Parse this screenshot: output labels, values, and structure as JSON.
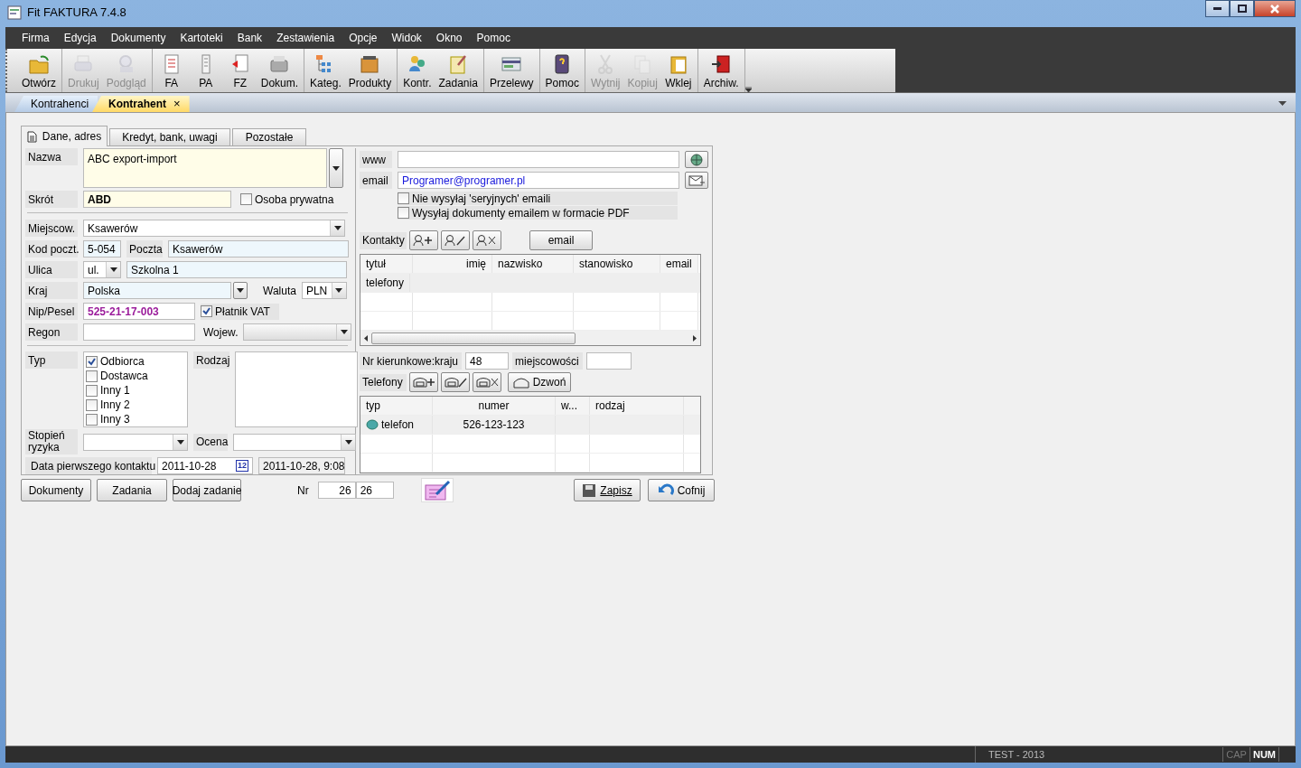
{
  "window": {
    "title": "Fit FAKTURA 7.4.8"
  },
  "menu": [
    "Firma",
    "Edycja",
    "Dokumenty",
    "Kartoteki",
    "Bank",
    "Zestawienia",
    "Opcje",
    "Widok",
    "Okno",
    "Pomoc"
  ],
  "toolbar": [
    [
      {
        "label": "Otwórz",
        "disabled": false
      }
    ],
    [
      {
        "label": "Drukuj",
        "disabled": true
      },
      {
        "label": "Podgląd",
        "disabled": true
      }
    ],
    [
      {
        "label": "FA",
        "disabled": false
      },
      {
        "label": "PA",
        "disabled": false
      },
      {
        "label": "FZ",
        "disabled": false
      },
      {
        "label": "Dokum.",
        "disabled": false
      }
    ],
    [
      {
        "label": "Kateg.",
        "disabled": false
      },
      {
        "label": "Produkty",
        "disabled": false
      }
    ],
    [
      {
        "label": "Kontr.",
        "disabled": false
      },
      {
        "label": "Zadania",
        "disabled": false
      }
    ],
    [
      {
        "label": "Przelewy",
        "disabled": false
      }
    ],
    [
      {
        "label": "Pomoc",
        "disabled": false
      }
    ],
    [
      {
        "label": "Wytnij",
        "disabled": true
      },
      {
        "label": "Kopiuj",
        "disabled": true
      },
      {
        "label": "Wklej",
        "disabled": false
      }
    ],
    [
      {
        "label": "Archiw.",
        "disabled": false
      }
    ]
  ],
  "doc_tabs": [
    {
      "label": "Kontrahenci",
      "selected": false
    },
    {
      "label": "Kontrahent",
      "selected": true,
      "close": "×"
    }
  ],
  "form_tabs": [
    {
      "label": "Dane, adres",
      "selected": true
    },
    {
      "label": "Kredyt, bank, uwagi",
      "selected": false
    },
    {
      "label": "Pozostałe",
      "selected": false
    }
  ],
  "nazwa": {
    "label": "Nazwa",
    "value": "ABC export-import"
  },
  "skrot": {
    "label": "Skrót",
    "value": "ABD"
  },
  "osoba_prywatna": {
    "label": "Osoba prywatna",
    "checked": false
  },
  "miejscowosc": {
    "label": "Miejscow.",
    "value": "Ksawerów"
  },
  "kod_pocztowy": {
    "label": "Kod poczt.",
    "value": "5-054"
  },
  "poczta": {
    "label": "Poczta",
    "value": "Ksawerów"
  },
  "ulica": {
    "label": "Ulica",
    "prefix": "ul.",
    "value": "Szkolna 1"
  },
  "kraj": {
    "label": "Kraj",
    "value": "Polska"
  },
  "waluta": {
    "label": "Waluta",
    "value": "PLN"
  },
  "nip": {
    "label": "Nip/Pesel",
    "value": "525-21-17-003"
  },
  "platnik_vat": {
    "label": "Płatnik VAT",
    "checked": true
  },
  "regon": {
    "label": "Regon"
  },
  "wojew": {
    "label": "Wojew."
  },
  "typ": {
    "label": "Typ",
    "options": [
      {
        "label": "Odbiorca",
        "checked": true
      },
      {
        "label": "Dostawca",
        "checked": false
      },
      {
        "label": "Inny 1",
        "checked": false
      },
      {
        "label": "Inny 2",
        "checked": false
      },
      {
        "label": "Inny 3",
        "checked": false
      }
    ]
  },
  "rodzaj": {
    "label": "Rodzaj"
  },
  "stopien_ryzyka": {
    "label": "Stopień ryzyka"
  },
  "ocena": {
    "label": "Ocena"
  },
  "data_kontaktu": {
    "label": "Data pierwszego kontaktu",
    "value": "2011-10-28",
    "calendar": "12",
    "timestamp": "2011-10-28, 9:08"
  },
  "www": {
    "label": "www"
  },
  "email": {
    "label": "email",
    "value": "Programer@programer.pl"
  },
  "email_options": [
    {
      "label": "Nie wysyłaj 'seryjnych' emaili",
      "checked": false
    },
    {
      "label": "Wysyłaj dokumenty emailem w formacie PDF",
      "checked": false
    }
  ],
  "kontakty": {
    "label": "Kontakty",
    "email_button": "email",
    "columns": [
      "tytuł",
      "imię",
      "nazwisko",
      "stanowisko",
      "email"
    ],
    "group_row": "telefony"
  },
  "nr_kierunkowe": {
    "label": "Nr kierunkowe:",
    "kraj_label": "kraju",
    "kraj": "48",
    "miejscowosci_label": "miejscowości"
  },
  "telefony": {
    "label": "Telefony",
    "dial_button": "Dzwoń",
    "columns": [
      "typ",
      "numer",
      "w...",
      "rodzaj"
    ],
    "rows": [
      {
        "typ": "telefon",
        "numer": "526-123-123"
      }
    ]
  },
  "bottom_buttons": [
    "Dokumenty",
    "Zadania",
    "Dodaj zadanie"
  ],
  "nr": {
    "label": "Nr",
    "value": "26",
    "value_2": "26"
  },
  "save_button": "Zapisz",
  "cancel_button": "Cofnij",
  "status_bar": {
    "text": "TEST - 2013",
    "cap": "CAP",
    "num": "NUM",
    "cap_on": false,
    "num_on": true
  }
}
